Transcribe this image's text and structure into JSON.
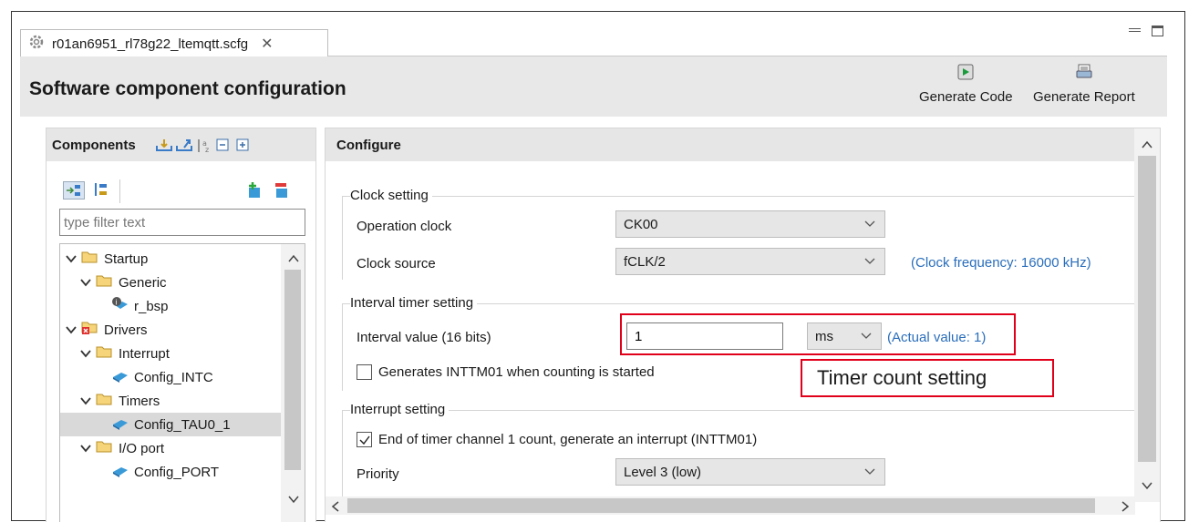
{
  "tab": {
    "title": "r01an6951_rl78g22_ltemqtt.scfg"
  },
  "header": {
    "title": "Software component configuration",
    "generate_code": "Generate Code",
    "generate_report": "Generate Report"
  },
  "components": {
    "title": "Components",
    "filter_placeholder": "type filter text",
    "tree": [
      {
        "label": "Startup"
      },
      {
        "label": "Generic"
      },
      {
        "label": "r_bsp"
      },
      {
        "label": "Drivers"
      },
      {
        "label": "Interrupt"
      },
      {
        "label": "Config_INTC"
      },
      {
        "label": "Timers"
      },
      {
        "label": "Config_TAU0_1"
      },
      {
        "label": "I/O port"
      },
      {
        "label": "Config_PORT"
      }
    ]
  },
  "configure": {
    "title": "Configure",
    "clock": {
      "group_title": "Clock setting",
      "operation_clock_label": "Operation clock",
      "operation_clock_value": "CK00",
      "clock_source_label": "Clock source",
      "clock_source_value": "fCLK/2",
      "clock_frequency": "(Clock frequency: 16000 kHz)"
    },
    "interval": {
      "group_title": "Interval timer setting",
      "interval_label": "Interval value (16 bits)",
      "interval_value": "1",
      "unit_value": "ms",
      "actual_value": "(Actual value: 1)",
      "start_interrupt_label": "Generates INTTM01 when counting is started",
      "start_interrupt_checked": false
    },
    "interrupt": {
      "group_title": "Interrupt setting",
      "end_count_label": "End of timer channel 1 count, generate an interrupt (INTTM01)",
      "end_count_checked": true,
      "priority_label": "Priority",
      "priority_value": "Level 3 (low)"
    }
  },
  "annotation": {
    "text": "Timer count setting"
  },
  "colors": {
    "annotation": "#e0001a",
    "link": "#2a6ebb",
    "panel_header": "#e6e6e6"
  }
}
